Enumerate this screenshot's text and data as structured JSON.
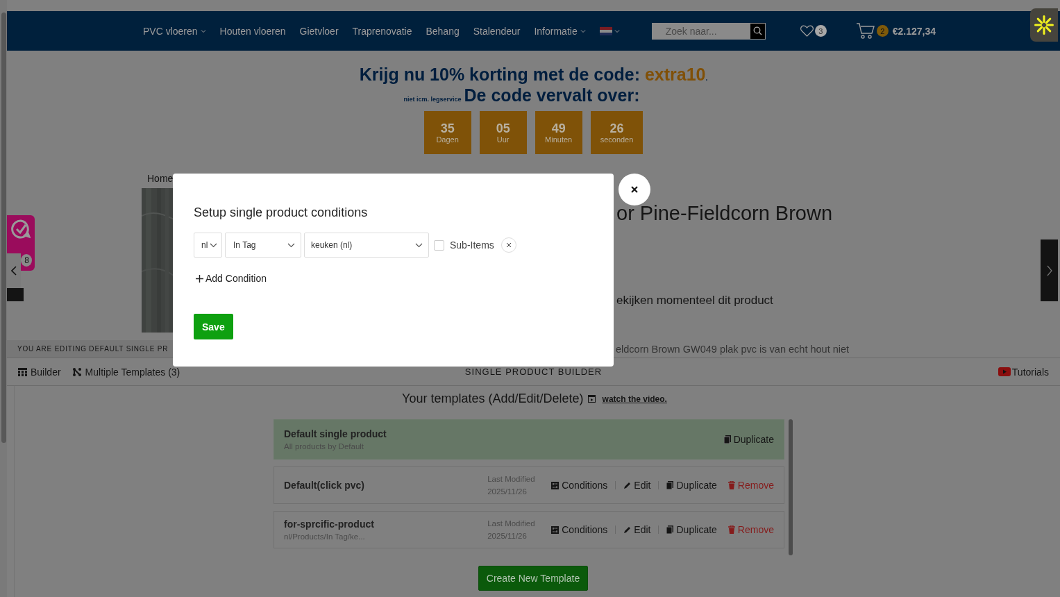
{
  "nav": {
    "items": [
      {
        "label": "PVC vloeren",
        "has_dropdown": true
      },
      {
        "label": "Houten vloeren",
        "has_dropdown": false
      },
      {
        "label": "Gietvloer",
        "has_dropdown": false
      },
      {
        "label": "Traprenovatie",
        "has_dropdown": false
      },
      {
        "label": "Behang",
        "has_dropdown": false
      },
      {
        "label": "Stalendeur",
        "has_dropdown": false
      },
      {
        "label": "Informatie",
        "has_dropdown": true
      }
    ],
    "search": {
      "placeholder": "Zoek naar..."
    },
    "wishlist_count": "3",
    "cart_count": "2",
    "cart_total": "€2.127,34"
  },
  "promo": {
    "heading": "Krijg nu 10% korting met de code: ",
    "code": "extra10",
    "period": ".",
    "note": "niet icm. legservice",
    "expires": "De code vervalt over:",
    "countdown": [
      {
        "value": "35",
        "unit": "Dagen"
      },
      {
        "value": "05",
        "unit": "Uur"
      },
      {
        "value": "49",
        "unit": "Minuten"
      },
      {
        "value": "26",
        "unit": "seconden"
      }
    ]
  },
  "product": {
    "breadcrumb": "Home",
    "title": "or Pine-Fieldcorn Brown",
    "viewers": "ekijken momenteel dit product",
    "description": "eldcorn Brown GW049 plak pvc is van echt hout niet",
    "side_badge": "8"
  },
  "builder": {
    "notice": "YOU ARE EDITING DEFAULT SINGLE PR",
    "tabs": [
      {
        "label": "Builder",
        "kind": "builder"
      },
      {
        "label": "Multiple Templates (3)",
        "kind": "templates"
      }
    ],
    "title": "SINGLE PRODUCT BUILDER",
    "tutorials": "Tutorials",
    "templates_heading": "Your templates (Add/Edit/Delete)",
    "video_link": "watch the video.",
    "templates": [
      {
        "name": "Default single product",
        "subtitle": "All products by Default",
        "selected": true,
        "actions": [
          {
            "label": "Duplicate",
            "kind": "duplicate"
          }
        ]
      },
      {
        "name": "Default(click pvc)",
        "modified_label": "Last Modified",
        "modified_date": "2025/11/26",
        "selected": false,
        "actions": [
          {
            "label": "Conditions",
            "kind": "conditions"
          },
          {
            "label": "Edit",
            "kind": "edit"
          },
          {
            "label": "Duplicate",
            "kind": "duplicate"
          },
          {
            "label": "Remove",
            "kind": "remove"
          }
        ]
      },
      {
        "name": "for-sprcific-product",
        "subtitle": "nl/Products/In Tag/ke...",
        "modified_label": "Last Modified",
        "modified_date": "2025/11/26",
        "selected": false,
        "actions": [
          {
            "label": "Conditions",
            "kind": "conditions"
          },
          {
            "label": "Edit",
            "kind": "edit"
          },
          {
            "label": "Duplicate",
            "kind": "duplicate"
          },
          {
            "label": "Remove",
            "kind": "remove"
          }
        ]
      }
    ],
    "create_button": "Create New Template"
  },
  "modal": {
    "title": "Setup single product conditions",
    "conditions": [
      {
        "language": "nl",
        "type": "In Tag",
        "value": "keuken (nl)",
        "sub_items_label": "Sub-Items",
        "sub_items": false
      }
    ],
    "add_condition": "Add Condition",
    "save": "Save"
  }
}
